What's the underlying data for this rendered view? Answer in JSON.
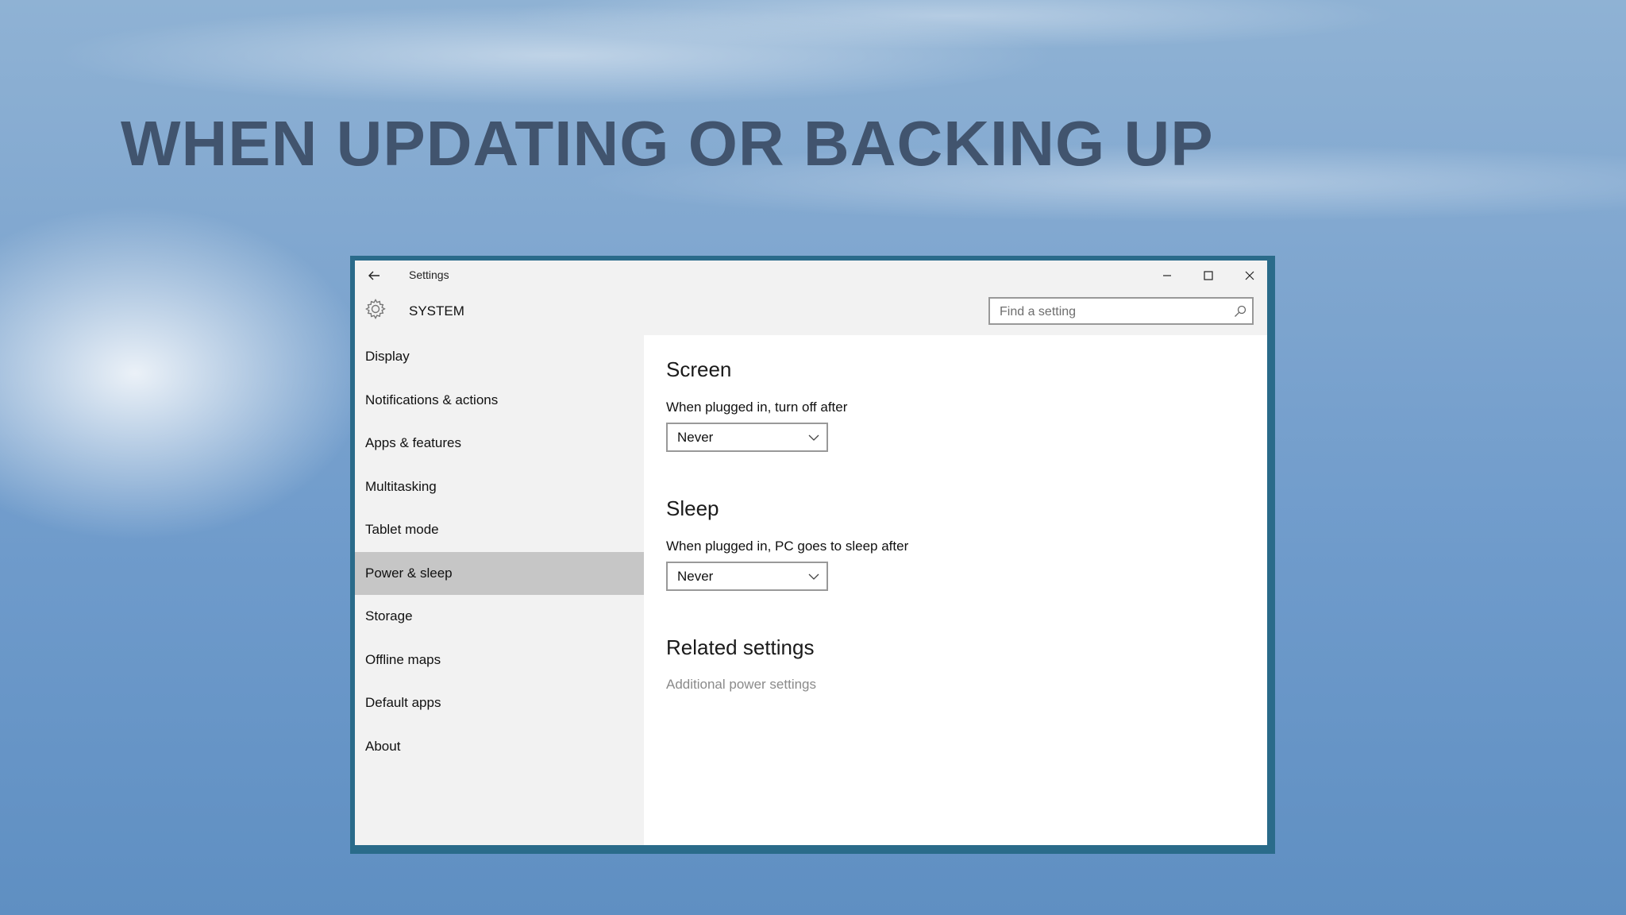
{
  "slide": {
    "title": "WHEN UPDATING OR BACKING UP"
  },
  "window": {
    "title": "Settings",
    "controls": {
      "minimize": "minimize-icon",
      "maximize": "maximize-icon",
      "close": "close-icon"
    }
  },
  "header": {
    "section": "SYSTEM",
    "search_placeholder": "Find a setting"
  },
  "sidebar": {
    "items": [
      {
        "label": "Display"
      },
      {
        "label": "Notifications & actions"
      },
      {
        "label": "Apps & features"
      },
      {
        "label": "Multitasking"
      },
      {
        "label": "Tablet mode"
      },
      {
        "label": "Power & sleep",
        "active": true
      },
      {
        "label": "Storage"
      },
      {
        "label": "Offline maps"
      },
      {
        "label": "Default apps"
      },
      {
        "label": "About"
      }
    ]
  },
  "main": {
    "screen": {
      "heading": "Screen",
      "label": "When plugged in, turn off after",
      "value": "Never"
    },
    "sleep": {
      "heading": "Sleep",
      "label": "When plugged in, PC goes to sleep after",
      "value": "Never"
    },
    "related": {
      "heading": "Related settings",
      "link": "Additional power settings"
    }
  },
  "colors": {
    "title_text": "#41546e",
    "window_border": "#2a6b8a",
    "active_nav": "#c6c6c6"
  }
}
